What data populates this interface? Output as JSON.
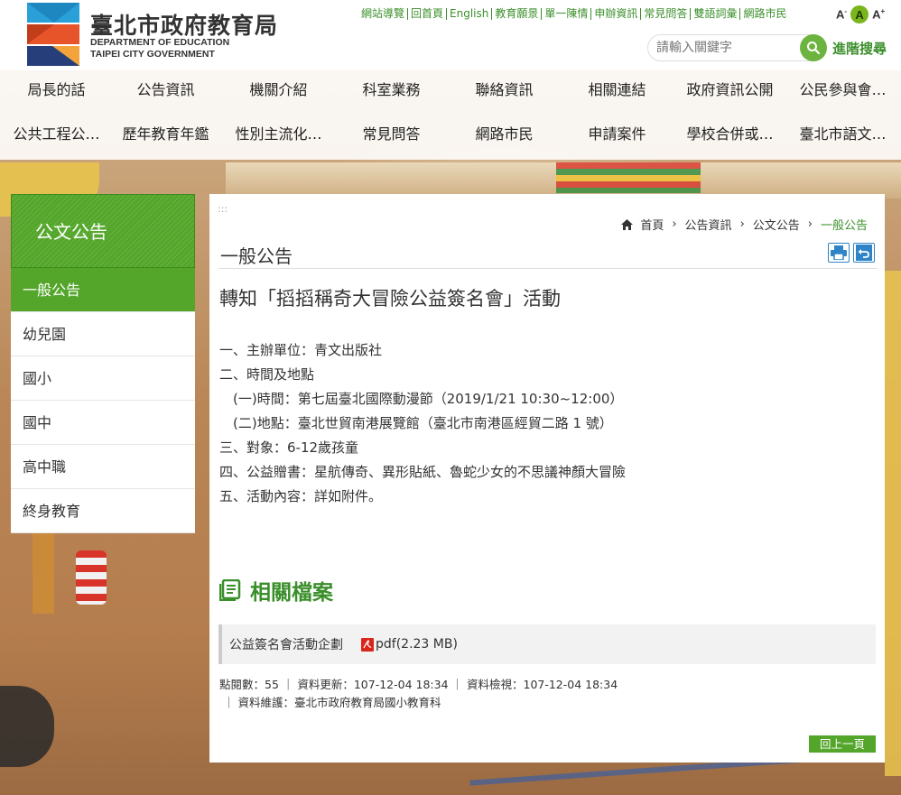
{
  "header": {
    "title_zh": "臺北市政府教育局",
    "title_en1": "DEPARTMENT OF  EDUCATION",
    "title_en2": "TAIPEI CITY GOVERNMENT",
    "top_links": [
      "網站導覽",
      "回首頁",
      "English",
      "教育願景",
      "單一陳情",
      "申辦資訊",
      "常見問答",
      "雙語詞彙",
      "網路市民"
    ],
    "font_sizes": [
      "A⁻",
      "A",
      "A⁺"
    ],
    "search_placeholder": "請輸入關鍵字",
    "advanced_search": "進階搜尋"
  },
  "nav": {
    "row1": [
      "局長的話",
      "公告資訊",
      "機關介紹",
      "科室業務",
      "聯絡資訊",
      "相關連結",
      "政府資訊公開",
      "公民參與會…"
    ],
    "row2": [
      "公共工程公…",
      "歷年教育年鑑",
      "性別主流化…",
      "常見問答",
      "網路市民",
      "申請案件",
      "學校合併或…",
      "臺北市語文…"
    ]
  },
  "sidebar": {
    "title": "公文公告",
    "items": [
      "一般公告",
      "幼兒園",
      "國小",
      "國中",
      "高中職",
      "終身教育"
    ],
    "active_index": 0
  },
  "main": {
    "dots": ":::",
    "breadcrumb": [
      "首頁",
      "公告資訊",
      "公文公告",
      "一般公告"
    ],
    "page_title": "一般公告",
    "article_title": "轉知「搯搯稱奇大冒險公益簽名會」活動",
    "body": [
      "一、主辦單位：青文出版社",
      "二、時間及地點",
      "　(一)時間：第七屆臺北國際動漫節（2019/1/21 10:30~12:00）",
      "　(二)地點：臺北世貿南港展覽館（臺北市南港區經貿二路 1 號）",
      "三、對象：6-12歲孩童",
      "四、公益贈書：星航傳奇、異形貼紙、魯蛇少女的不思議神顏大冒險",
      "五、活動內容：詳如附件。"
    ],
    "related_title": "相關檔案",
    "file": {
      "name": "公益簽名會活動企劃",
      "type": "pdf(2.23 MB)"
    },
    "meta_line1": "點閱數：55 ｜ 資料更新：107-12-04 18:34 ｜ 資料檢視：107-12-04 18:34",
    "meta_line2": "｜ 資料維護：臺北市政府教育局國小教育科",
    "back_button": "回上一頁"
  },
  "colors": {
    "brand_green": "#53a62a",
    "link_green": "#3b8f2b",
    "tool_blue": "#2e84c6",
    "pdf_red": "#d9261c"
  }
}
